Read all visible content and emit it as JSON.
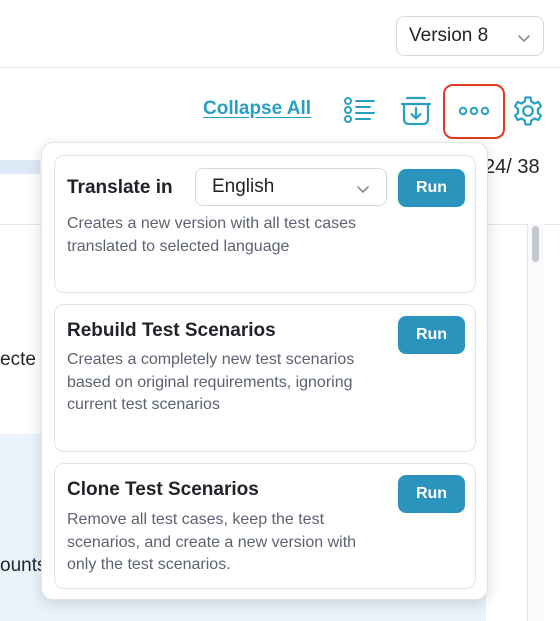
{
  "header": {
    "version_select": {
      "value": "Version 8",
      "icon": "chevron-down-icon"
    }
  },
  "toolbar": {
    "collapse_all_label": "Collapse All",
    "icons": [
      "list-outline-icon",
      "download-tray-icon",
      "more-options-icon",
      "gear-icon"
    ],
    "accent_color": "#2aa0c1",
    "highlight_color": "#e03a1f"
  },
  "background": {
    "page_counter": "24/ 38",
    "partial_texts": [
      "ecte",
      "ounts"
    ]
  },
  "menu": {
    "items": [
      {
        "title": "Translate in",
        "language_select": {
          "value": "English",
          "icon": "chevron-down-icon"
        },
        "description": "Creates a new version with all test cases translated to selected language",
        "action_label": "Run"
      },
      {
        "title": "Rebuild Test Scenarios",
        "description": "Creates a completely new test scenarios based on original requirements, ignoring current test scenarios",
        "action_label": "Run"
      },
      {
        "title": "Clone Test Scenarios",
        "description": "Remove all test cases, keep the test scenarios, and create a new version with only the test scenarios.",
        "action_label": "Run"
      }
    ],
    "run_button_color": "#2b94bd"
  }
}
